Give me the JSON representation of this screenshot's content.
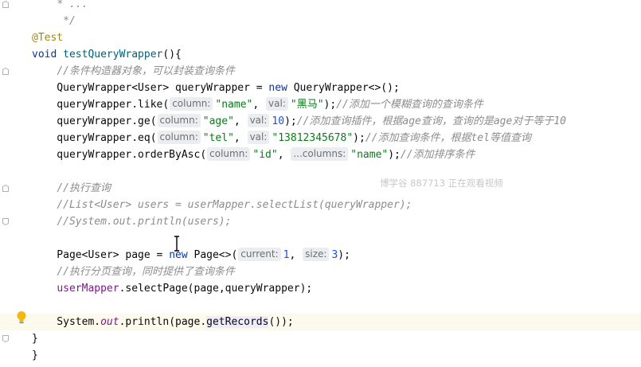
{
  "editor": {
    "lines": [
      {
        "id": "l0",
        "segs": [
          {
            "t": "    ",
            "c": ""
          },
          {
            "t": "* ... ",
            "c": "cmt"
          }
        ]
      },
      {
        "id": "l1",
        "segs": [
          {
            "t": "     */",
            "c": "cmt"
          }
        ]
      },
      {
        "id": "l2",
        "segs": [
          {
            "t": "@Test",
            "c": "ann"
          }
        ]
      },
      {
        "id": "l3",
        "segs": [
          {
            "t": "void ",
            "c": "kw"
          },
          {
            "t": "testQueryWrapper",
            "c": "fn"
          },
          {
            "t": "(){",
            "c": ""
          }
        ]
      },
      {
        "id": "l4",
        "segs": [
          {
            "t": "    ",
            "c": ""
          },
          {
            "t": "//条件构造器对象，可以封装查询条件",
            "c": "cmt"
          }
        ]
      },
      {
        "id": "l5",
        "segs": [
          {
            "t": "    QueryWrapper<User> queryWrapper = ",
            "c": ""
          },
          {
            "t": "new ",
            "c": "kw"
          },
          {
            "t": "QueryWrapper<>();",
            "c": ""
          }
        ]
      },
      {
        "id": "l6",
        "segs": [
          {
            "t": "    queryWrapper.like(",
            "c": ""
          },
          {
            "h": "column:"
          },
          {
            "t": "\"name\"",
            "c": "str"
          },
          {
            "t": ", ",
            "c": ""
          },
          {
            "h": "val:"
          },
          {
            "t": "\"黑马\"",
            "c": "str"
          },
          {
            "t": ");",
            "c": ""
          },
          {
            "t": "//添加一个模糊查询的查询条件",
            "c": "cmt"
          }
        ]
      },
      {
        "id": "l7",
        "segs": [
          {
            "t": "    queryWrapper.ge(",
            "c": ""
          },
          {
            "h": "column:"
          },
          {
            "t": "\"age\"",
            "c": "str"
          },
          {
            "t": ", ",
            "c": ""
          },
          {
            "h": "val:"
          },
          {
            "t": "10",
            "c": "num"
          },
          {
            "t": ");",
            "c": ""
          },
          {
            "t": "//添加查询插件，根据age查询，查询的是age对于等于10",
            "c": "cmt"
          }
        ]
      },
      {
        "id": "l8",
        "segs": [
          {
            "t": "    queryWrapper.eq(",
            "c": ""
          },
          {
            "h": "column:"
          },
          {
            "t": "\"tel\"",
            "c": "str"
          },
          {
            "t": ", ",
            "c": ""
          },
          {
            "h": "val:"
          },
          {
            "t": "\"13812345678\"",
            "c": "str"
          },
          {
            "t": ");",
            "c": ""
          },
          {
            "t": "//添加查询条件，根据tel等值查询",
            "c": "cmt"
          }
        ]
      },
      {
        "id": "l9",
        "segs": [
          {
            "t": "    queryWrapper.orderByAsc(",
            "c": ""
          },
          {
            "h": "column:"
          },
          {
            "t": "\"id\"",
            "c": "str"
          },
          {
            "t": ", ",
            "c": ""
          },
          {
            "h": "...columns:"
          },
          {
            "t": "\"name\"",
            "c": "str"
          },
          {
            "t": ");",
            "c": ""
          },
          {
            "t": "//添加排序条件",
            "c": "cmt"
          }
        ]
      },
      {
        "id": "l10",
        "segs": []
      },
      {
        "id": "l11",
        "segs": [
          {
            "t": "    ",
            "c": ""
          },
          {
            "t": "//执行查询",
            "c": "cmt"
          }
        ]
      },
      {
        "id": "l12",
        "segs": [
          {
            "t": "    ",
            "c": ""
          },
          {
            "t": "//List<User> users = userMapper.selectList(queryWrapper);",
            "c": "cmt"
          }
        ]
      },
      {
        "id": "l13",
        "segs": [
          {
            "t": "    ",
            "c": ""
          },
          {
            "t": "//System.out.println(users);",
            "c": "cmt"
          }
        ]
      },
      {
        "id": "l14",
        "segs": []
      },
      {
        "id": "l15",
        "segs": [
          {
            "t": "    Page<User> page = ",
            "c": ""
          },
          {
            "t": "new ",
            "c": "kw"
          },
          {
            "t": "Page<>(",
            "c": ""
          },
          {
            "h": "current:"
          },
          {
            "t": "1",
            "c": "num"
          },
          {
            "t": ", ",
            "c": ""
          },
          {
            "h": "size:"
          },
          {
            "t": "3",
            "c": "num"
          },
          {
            "t": ");",
            "c": ""
          }
        ]
      },
      {
        "id": "l16",
        "segs": [
          {
            "t": "    ",
            "c": ""
          },
          {
            "t": "//执行分页查询，同时提供了查询条件",
            "c": "cmt"
          }
        ]
      },
      {
        "id": "l17",
        "segs": [
          {
            "t": "    ",
            "c": ""
          },
          {
            "t": "userMapper",
            "c": "var"
          },
          {
            "t": ".selectPage(page,queryWrapper);",
            "c": ""
          }
        ]
      },
      {
        "id": "l18",
        "segs": []
      },
      {
        "id": "l19",
        "caret": true,
        "segs": [
          {
            "t": "    System.",
            "c": ""
          },
          {
            "t": "out",
            "c": "field"
          },
          {
            "t": ".println(page.",
            "c": ""
          },
          {
            "t": "getRecords",
            "c": "meth-hl"
          },
          {
            "t": "());",
            "c": ""
          }
        ]
      },
      {
        "id": "l20",
        "segs": [
          {
            "t": "}",
            "c": ""
          }
        ]
      },
      {
        "id": "l21",
        "segs": [
          {
            "t": "}",
            "c": ""
          }
        ]
      }
    ]
  },
  "watermark": "博学谷 887713 正在观看视频",
  "icons": {
    "intention": "lightbulb-icon",
    "fold": "fold-marker-icon",
    "cursor": "text-cursor-icon"
  },
  "colors": {
    "keyword": "#0033b3",
    "string": "#067d17",
    "number": "#1750eb",
    "comment": "#8c8c8c",
    "annotation": "#9e880d",
    "method_decl": "#00627a",
    "field": "#871094",
    "caret_line": "#fcfaed",
    "hint_bg": "#ebedf0"
  }
}
